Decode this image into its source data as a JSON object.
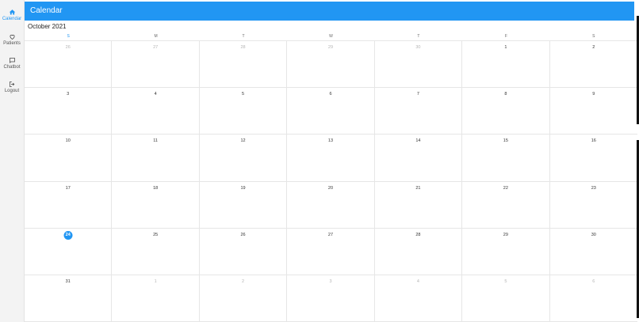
{
  "sidebar": {
    "items": [
      {
        "label": "Calendar",
        "icon": "home-icon",
        "active": true
      },
      {
        "label": "Patients",
        "icon": "heart-icon",
        "active": false
      },
      {
        "label": "Chatbot",
        "icon": "chat-icon",
        "active": false
      },
      {
        "label": "Logout",
        "icon": "logout-icon",
        "active": false
      }
    ]
  },
  "header": {
    "title": "Calendar"
  },
  "calendar": {
    "month_label": "October 2021",
    "weekdays": [
      "S",
      "M",
      "T",
      "W",
      "T",
      "F",
      "S"
    ],
    "today": "24",
    "weeks": [
      [
        {
          "d": "26",
          "muted": true
        },
        {
          "d": "27",
          "muted": true
        },
        {
          "d": "28",
          "muted": true
        },
        {
          "d": "29",
          "muted": true
        },
        {
          "d": "30",
          "muted": true
        },
        {
          "d": "1"
        },
        {
          "d": "2"
        }
      ],
      [
        {
          "d": "3"
        },
        {
          "d": "4"
        },
        {
          "d": "5"
        },
        {
          "d": "6"
        },
        {
          "d": "7"
        },
        {
          "d": "8"
        },
        {
          "d": "9"
        }
      ],
      [
        {
          "d": "10"
        },
        {
          "d": "11"
        },
        {
          "d": "12"
        },
        {
          "d": "13"
        },
        {
          "d": "14"
        },
        {
          "d": "15"
        },
        {
          "d": "16"
        }
      ],
      [
        {
          "d": "17"
        },
        {
          "d": "18"
        },
        {
          "d": "19"
        },
        {
          "d": "20"
        },
        {
          "d": "21"
        },
        {
          "d": "22"
        },
        {
          "d": "23"
        }
      ],
      [
        {
          "d": "24",
          "today": true
        },
        {
          "d": "25"
        },
        {
          "d": "26"
        },
        {
          "d": "27"
        },
        {
          "d": "28"
        },
        {
          "d": "29"
        },
        {
          "d": "30"
        }
      ],
      [
        {
          "d": "31"
        },
        {
          "d": "1",
          "muted": true
        },
        {
          "d": "2",
          "muted": true
        },
        {
          "d": "3",
          "muted": true
        },
        {
          "d": "4",
          "muted": true
        },
        {
          "d": "5",
          "muted": true
        },
        {
          "d": "6",
          "muted": true
        }
      ]
    ]
  },
  "colors": {
    "accent": "#2196f3",
    "muted_text": "#b5b5b5"
  }
}
